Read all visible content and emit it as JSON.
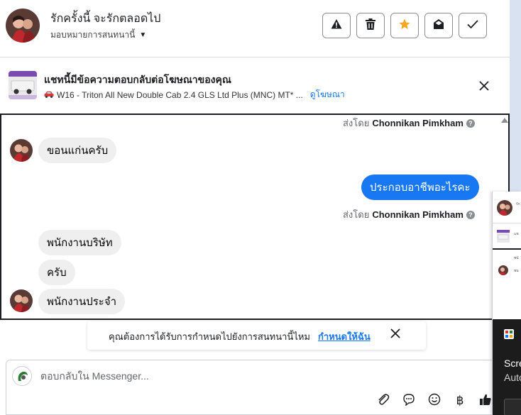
{
  "header": {
    "title": "รักครั้งนี้ จะรักตลอดไป",
    "subtitle": "มอบหมายการสนทนานี้",
    "actions": [
      "report",
      "delete",
      "star",
      "mark-unread",
      "done"
    ]
  },
  "ad_banner": {
    "title": "แชทนี้มีข้อความตอบกลับต่อโฆษณาของคุณ",
    "ad_text": "W16 - Triton All New Double Cab 2.4 GLS Ltd Plus (MNC) MT* ...",
    "link_label": "ดูโฆษณา"
  },
  "conversation": {
    "sent_by_prefix": "ส่งโดย",
    "sender_name": "Chonnikan Pimkham",
    "help_mark": "?",
    "messages": [
      {
        "direction": "in",
        "text": "ขอนแก่นครับ"
      },
      {
        "direction": "out",
        "text": "ประกอบอาชีพอะไรคะ"
      },
      {
        "direction": "in",
        "text": "พนักงานบริษัท"
      },
      {
        "direction": "in",
        "text": "ครับ"
      },
      {
        "direction": "in",
        "text": "พนักงานประจำ"
      }
    ]
  },
  "notify": {
    "text": "คุณต้องการได้รับการกำหนดไปยังการสนทนานี้ไหม",
    "link": "กำหนดให้ฉัน"
  },
  "reply": {
    "placeholder": "ตอบกลับใน Messenger...",
    "tools": [
      "paperclip-icon",
      "saved-reply-icon",
      "emoji-icon",
      "baht-icon",
      "thumbs-up-icon"
    ],
    "baht_symbol": "฿"
  },
  "overlay": {
    "line1": "Scre",
    "line2": "Auto",
    "mini1": "รัก",
    "mini2": "แช",
    "mini3": "พนั",
    "mini4": "พน"
  },
  "colors": {
    "accent": "#1877f2",
    "star": "#f5a623",
    "incoming_bubble": "#efefef",
    "border": "#dadde1"
  }
}
